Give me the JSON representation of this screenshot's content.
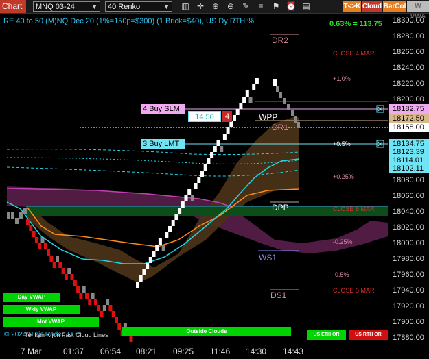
{
  "toolbar": {
    "chart_label": "Chart",
    "instrument": "MNQ 03-24",
    "bar_type": "40 Renko",
    "badges": [
      {
        "label": "T<>K",
        "bg": "#e67e22",
        "fg": "#fff"
      },
      {
        "label": "Cloud",
        "bg": "#c0392b",
        "fg": "#fff"
      },
      {
        "label": "BarCol",
        "bg": "#e67e22",
        "fg": "#fff"
      },
      {
        "label": "W VWA",
        "bg": "#bbbbbb",
        "fg": "#666"
      }
    ],
    "icons": [
      "bar-chart-icon",
      "crosshair-icon",
      "zoom-in-icon",
      "zoom-out-icon",
      "pencil-icon",
      "properties-icon",
      "strategy-icon",
      "alert-icon",
      "template-icon"
    ]
  },
  "chart": {
    "info_line": "RE 40 to 50 (M)NQ Dec 20 (1%=150p=$300) (1 Brick=$40), US Dy RTH %",
    "stat": "0.63% = 113.75",
    "watermark": "© 2024 NinjaTrader, LLC",
    "bottom_note": "Tenkan Kijun Fast Cloud Lines"
  },
  "levels": {
    "dr2": "DR2",
    "dr1": "DR1",
    "wpp": "WPP",
    "dpp": "DPP",
    "ws1": "WS1",
    "ds1": "DS1",
    "close_4_mar": "CLOSE 4 MAR",
    "close_6_mar": "CLOSE 6 MAR",
    "close_5_mar": "CLOSE 5 MAR",
    "pct_plus1": "+1.0%",
    "pct_plus05": "+0.5%",
    "pct_plus025": "+0.25%",
    "pct_minus025": "-0.25%",
    "pct_minus05": "-0.5%"
  },
  "orders": {
    "buy_slm": "4 Buy SLM",
    "buy_lmt": "3 Buy LMT",
    "qty_value": "14.50",
    "qty_count": "4"
  },
  "price_labels": [
    {
      "value": "18182.75",
      "bg": "#f0a8f0"
    },
    {
      "value": "18172.50",
      "bg": "#d8b88a"
    },
    {
      "value": "18158.00",
      "bg": "#ffffff"
    },
    {
      "value": "18134.75",
      "bg": "#6fe4f4"
    },
    {
      "value": "18123.39",
      "bg": "#6fe4f4"
    },
    {
      "value": "18114.01",
      "bg": "#6fe4f4"
    },
    {
      "value": "18102.11",
      "bg": "#6fe4f4"
    }
  ],
  "price_ticks": [
    "18300.00",
    "18280.00",
    "18260.00",
    "18240.00",
    "18220.00",
    "18200.00",
    "18080.00",
    "18060.00",
    "18040.00",
    "18020.00",
    "18000.00",
    "17980.00",
    "17960.00",
    "17940.00",
    "17920.00",
    "17900.00",
    "17880.00"
  ],
  "time_ticks": [
    "7 Mar",
    "01:37",
    "06:54",
    "08:21",
    "09:25",
    "11:46",
    "14:30",
    "14:43"
  ],
  "buttons": {
    "day_vwap": "Day VWAP",
    "wkly_vwap": "Wkly VWAP",
    "mnt_vwap": "Mnt VWAP",
    "outside_clouds": "Outside Clouds",
    "us_eth_or": "US ETH OR",
    "us_rth_or": "US RTH OR"
  },
  "colors": {
    "up_brick": "#ffffff",
    "down_brick": "#e01010",
    "cloud_magenta": "#5a1f4a",
    "cloud_brown": "#4a3218",
    "cyan": "#20d8e8",
    "orange": "#ff8c1a",
    "magenta_line": "#c040b0",
    "green_zone": "#0d4d1a"
  }
}
